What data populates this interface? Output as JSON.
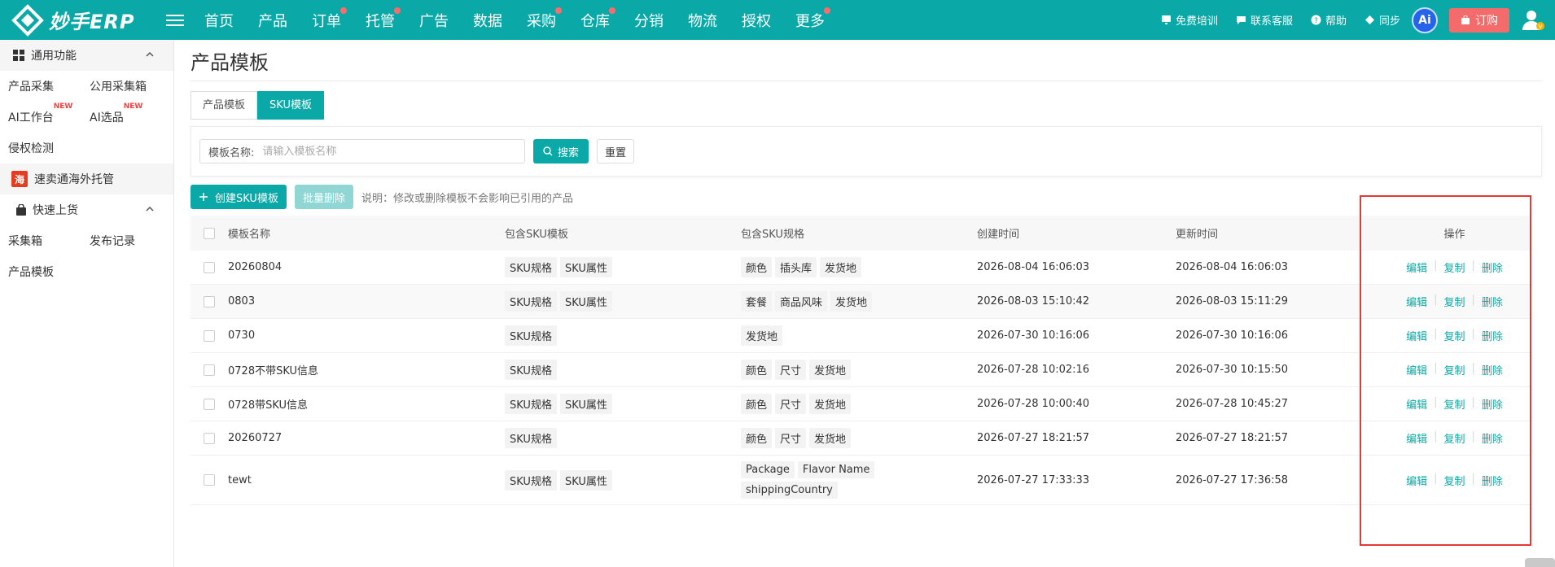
{
  "header": {
    "logo_text": "妙手ERP",
    "nav": [
      {
        "label": "首页",
        "dot": false
      },
      {
        "label": "产品",
        "dot": false
      },
      {
        "label": "订单",
        "dot": true
      },
      {
        "label": "托管",
        "dot": true
      },
      {
        "label": "广告",
        "dot": false
      },
      {
        "label": "数据",
        "dot": false
      },
      {
        "label": "采购",
        "dot": true
      },
      {
        "label": "仓库",
        "dot": true
      },
      {
        "label": "分销",
        "dot": false
      },
      {
        "label": "物流",
        "dot": false
      },
      {
        "label": "授权",
        "dot": false
      },
      {
        "label": "更多",
        "dot": true
      }
    ],
    "right": {
      "training": "免费培训",
      "service": "联系客服",
      "help": "帮助",
      "sync": "同步",
      "ai": "Ai",
      "order": "订购"
    },
    "colors": {
      "bar": "#0aa8a6",
      "dot": "#ff6b6b",
      "order": "#f36b6b"
    }
  },
  "sidebar": {
    "group1": "通用功能",
    "row1": [
      "产品采集",
      "公用采集箱"
    ],
    "row2": [
      {
        "label": "AI工作台",
        "tag": "NEW"
      },
      {
        "label": "AI选品",
        "tag": "NEW"
      }
    ],
    "row3": "侵权检测",
    "special_icon": "海",
    "special": "速卖通海外托管",
    "group2": "快速上货",
    "row4": [
      "采集箱",
      "发布记录"
    ],
    "row5": "产品模板"
  },
  "main": {
    "title": "产品模板",
    "tabs": [
      "产品模板",
      "SKU模板"
    ],
    "active_tab": "SKU模板",
    "search": {
      "label": "模板名称:",
      "placeholder": "请输入模板名称",
      "value": "",
      "search_btn": "搜索",
      "reset_btn": "重置"
    },
    "actions": {
      "create": "创建SKU模板",
      "batch_delete": "批量删除",
      "note": "说明：修改或删除模板不会影响已引用的产品"
    },
    "table": {
      "headers": [
        "模板名称",
        "包含SKU模板",
        "包含SKU规格",
        "创建时间",
        "更新时间",
        "操作"
      ],
      "rows": [
        {
          "name": "20260804",
          "tpl": [
            "SKU规格",
            "SKU属性"
          ],
          "spec": [
            "颜色",
            "插头库",
            "发货地"
          ],
          "created": "2026-08-04 16:06:03",
          "updated": "2026-08-04 16:06:03"
        },
        {
          "name": "0803",
          "tpl": [
            "SKU规格",
            "SKU属性"
          ],
          "spec": [
            "套餐",
            "商品风味",
            "发货地"
          ],
          "created": "2026-08-03 15:10:42",
          "updated": "2026-08-03 15:11:29"
        },
        {
          "name": "0730",
          "tpl": [
            "SKU规格"
          ],
          "spec": [
            "发货地"
          ],
          "created": "2026-07-30 10:16:06",
          "updated": "2026-07-30 10:16:06"
        },
        {
          "name": "0728不带SKU信息",
          "tpl": [
            "SKU规格"
          ],
          "spec": [
            "颜色",
            "尺寸",
            "发货地"
          ],
          "created": "2026-07-28 10:02:16",
          "updated": "2026-07-30 10:15:50"
        },
        {
          "name": "0728带SKU信息",
          "tpl": [
            "SKU规格",
            "SKU属性"
          ],
          "spec": [
            "颜色",
            "尺寸",
            "发货地"
          ],
          "created": "2026-07-28 10:00:40",
          "updated": "2026-07-28 10:45:27"
        },
        {
          "name": "20260727",
          "tpl": [
            "SKU规格"
          ],
          "spec": [
            "颜色",
            "尺寸",
            "发货地"
          ],
          "created": "2026-07-27 18:21:57",
          "updated": "2026-07-27 18:21:57"
        },
        {
          "name": "tewt",
          "tpl": [
            "SKU规格",
            "SKU属性"
          ],
          "spec": [
            "Package",
            "Flavor Name",
            "shippingCountry"
          ],
          "created": "2026-07-27 17:33:33",
          "updated": "2026-07-27 17:36:58"
        }
      ],
      "ops": {
        "edit": "编辑",
        "copy": "复制",
        "delete": "删除"
      }
    }
  }
}
